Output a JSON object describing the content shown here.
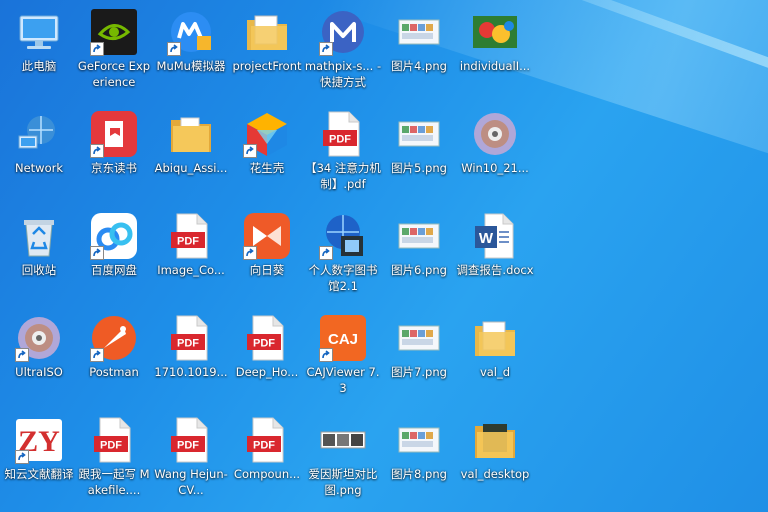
{
  "icons": [
    {
      "col": 0,
      "row": 0,
      "icon": "computer-icon",
      "label": "此电脑",
      "shortcut": false
    },
    {
      "col": 1,
      "row": 0,
      "icon": "nvidia-icon",
      "label": "GeForce Experience",
      "shortcut": true
    },
    {
      "col": 2,
      "row": 0,
      "icon": "mumu-icon",
      "label": "MuMu模拟器",
      "shortcut": true
    },
    {
      "col": 3,
      "row": 0,
      "icon": "folder-doc-icon",
      "label": "projectFront",
      "shortcut": false
    },
    {
      "col": 4,
      "row": 0,
      "icon": "mathpix-icon",
      "label": "mathpix-s... - 快捷方式",
      "shortcut": true
    },
    {
      "col": 5,
      "row": 0,
      "icon": "image-thumb-icon",
      "label": "图片4.png",
      "shortcut": false
    },
    {
      "col": 6,
      "row": 0,
      "icon": "photo-parrot-icon",
      "label": "individualI...",
      "shortcut": false
    },
    {
      "col": 0,
      "row": 1,
      "icon": "network-icon",
      "label": "Network",
      "shortcut": false
    },
    {
      "col": 1,
      "row": 1,
      "icon": "jd-reader-icon",
      "label": "京东读书",
      "shortcut": true
    },
    {
      "col": 2,
      "row": 1,
      "icon": "folder-icon",
      "label": "Abiqu_Assi...",
      "shortcut": false
    },
    {
      "col": 3,
      "row": 1,
      "icon": "huashengke-icon",
      "label": "花生壳",
      "shortcut": true
    },
    {
      "col": 4,
      "row": 1,
      "icon": "pdf-icon",
      "label": "【34 注意力机制】.pdf",
      "shortcut": false
    },
    {
      "col": 5,
      "row": 1,
      "icon": "image-thumb-icon",
      "label": "图片5.png",
      "shortcut": false
    },
    {
      "col": 6,
      "row": 1,
      "icon": "disc-icon",
      "label": "Win10_21...",
      "shortcut": false
    },
    {
      "col": 0,
      "row": 2,
      "icon": "recycle-bin-icon",
      "label": "回收站",
      "shortcut": false
    },
    {
      "col": 1,
      "row": 2,
      "icon": "baidu-netdisk-icon",
      "label": "百度网盘",
      "shortcut": true
    },
    {
      "col": 2,
      "row": 2,
      "icon": "pdf-icon",
      "label": "Image_Co...",
      "shortcut": false
    },
    {
      "col": 3,
      "row": 2,
      "icon": "sunflower-icon",
      "label": "向日葵",
      "shortcut": true
    },
    {
      "col": 4,
      "row": 2,
      "icon": "digital-library-icon",
      "label": "个人数字图书馆2.1",
      "shortcut": true
    },
    {
      "col": 5,
      "row": 2,
      "icon": "image-thumb-icon",
      "label": "图片6.png",
      "shortcut": false
    },
    {
      "col": 6,
      "row": 2,
      "icon": "word-doc-icon",
      "label": "调查报告.docx",
      "shortcut": false
    },
    {
      "col": 0,
      "row": 3,
      "icon": "disc-icon",
      "label": "UltraISO",
      "shortcut": true
    },
    {
      "col": 1,
      "row": 3,
      "icon": "postman-icon",
      "label": "Postman",
      "shortcut": true
    },
    {
      "col": 2,
      "row": 3,
      "icon": "pdf-icon",
      "label": "1710.1019...",
      "shortcut": false
    },
    {
      "col": 3,
      "row": 3,
      "icon": "pdf-icon",
      "label": "Deep_Ho...",
      "shortcut": false
    },
    {
      "col": 4,
      "row": 3,
      "icon": "cajviewer-icon",
      "label": "CAJViewer 7.3",
      "shortcut": true
    },
    {
      "col": 5,
      "row": 3,
      "icon": "image-thumb-icon",
      "label": "图片7.png",
      "shortcut": false
    },
    {
      "col": 6,
      "row": 3,
      "icon": "folder-doc-icon",
      "label": "val_d",
      "shortcut": false
    },
    {
      "col": 0,
      "row": 4,
      "icon": "zhiyun-icon",
      "label": "知云文献翻译",
      "shortcut": true
    },
    {
      "col": 1,
      "row": 4,
      "icon": "pdf-icon",
      "label": "跟我一起写 Makefile....",
      "shortcut": false
    },
    {
      "col": 2,
      "row": 4,
      "icon": "pdf-icon",
      "label": "Wang Hejun-CV...",
      "shortcut": false
    },
    {
      "col": 3,
      "row": 4,
      "icon": "pdf-icon",
      "label": "Compoun...",
      "shortcut": false
    },
    {
      "col": 4,
      "row": 4,
      "icon": "image-strip-icon",
      "label": "爱因斯坦对比图.png",
      "shortcut": false
    },
    {
      "col": 5,
      "row": 4,
      "icon": "image-thumb-icon",
      "label": "图片8.png",
      "shortcut": false
    },
    {
      "col": 6,
      "row": 4,
      "icon": "folder-dark-icon",
      "label": "val_desktop",
      "shortcut": false
    }
  ],
  "pdf_text": "PDF",
  "caj_text": "CAJ",
  "zy_text": "ZY",
  "colors": {
    "pdf_red": "#d9272e",
    "nvidia_green": "#76b900",
    "jd_red": "#e4393c",
    "postman_orange": "#ef5b25",
    "caj_orange": "#f26722",
    "word_blue": "#2b579a",
    "folder_yellow": "#f5c85a"
  }
}
